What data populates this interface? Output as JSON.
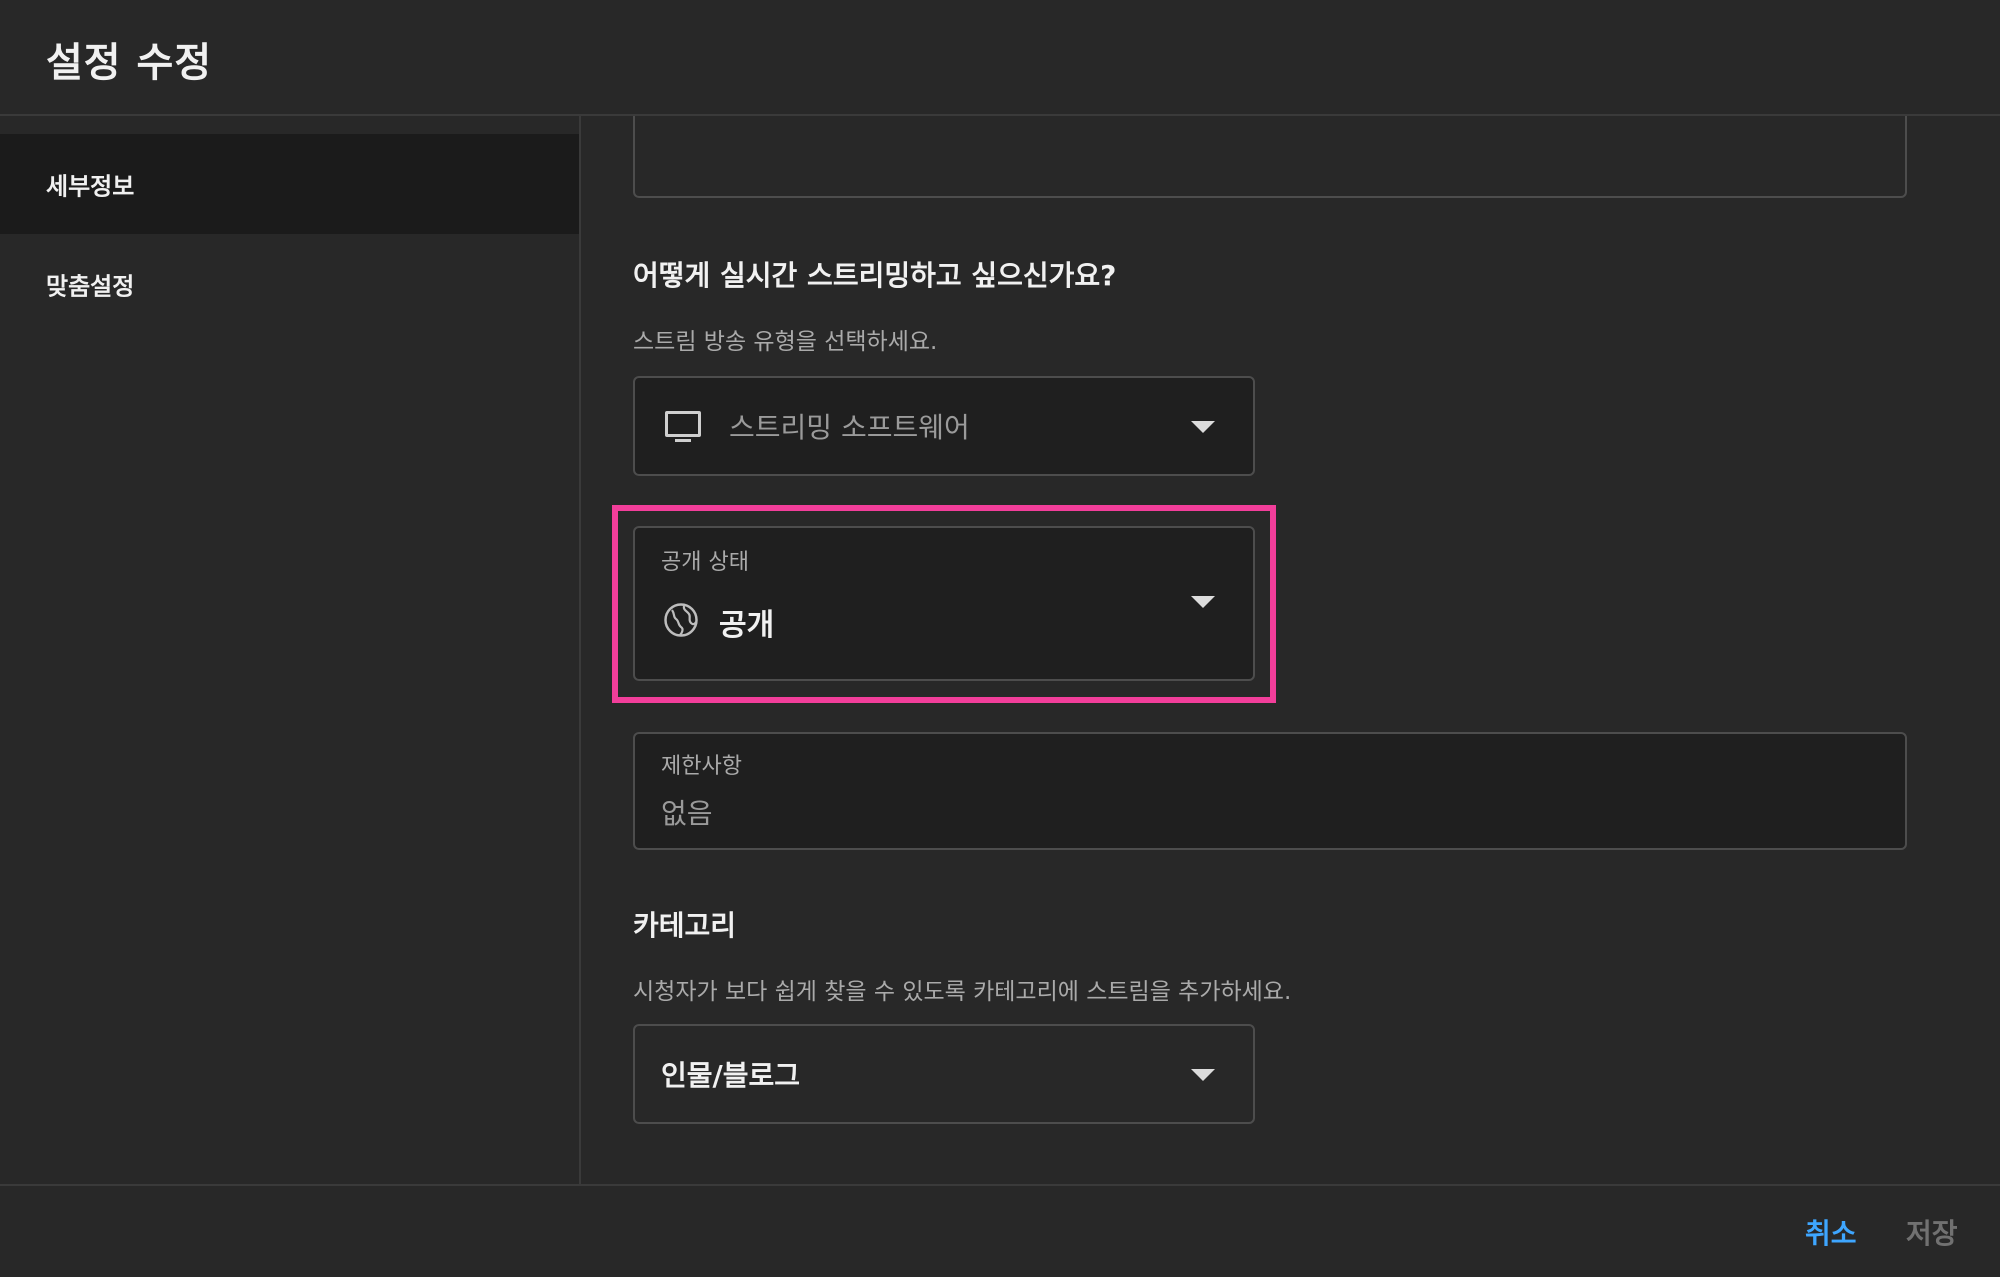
{
  "header": {
    "title": "설정 수정"
  },
  "sidebar": {
    "items": [
      {
        "label": "세부정보",
        "active": true
      },
      {
        "label": "맞춤설정",
        "active": false
      }
    ]
  },
  "main": {
    "stream_section": {
      "title": "어떻게 실시간 스트리밍하고 싶으신가요?",
      "subtitle": "스트림 방송 유형을 선택하세요.",
      "stream_type": {
        "value": "스트리밍 소프트웨어",
        "icon": "monitor-icon"
      }
    },
    "visibility": {
      "caption": "공개 상태",
      "value": "공개",
      "icon": "globe-icon",
      "highlight_color": "#f23e9a"
    },
    "restrictions": {
      "caption": "제한사항",
      "value": "없음"
    },
    "category_section": {
      "title": "카테고리",
      "subtitle": "시청자가 보다 쉽게 찾을 수 있도록 카테고리에 스트림을 추가하세요.",
      "value": "인물/블로그"
    }
  },
  "footer": {
    "cancel_label": "취소",
    "save_label": "저장",
    "accent_color": "#3ea6ff"
  }
}
